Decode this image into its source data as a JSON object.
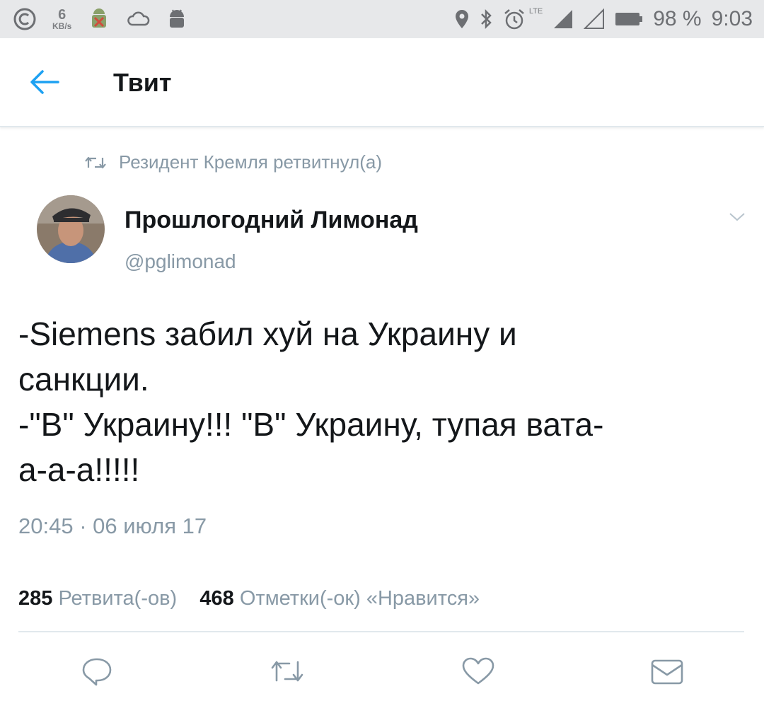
{
  "status_bar": {
    "net_speed_value": "6",
    "net_speed_unit": "KB/s",
    "network_type": "LTE",
    "battery": "98 %",
    "time": "9:03"
  },
  "header": {
    "title": "Твит"
  },
  "retweet": {
    "text": "Резидент Кремля ретвитнул(а)"
  },
  "author": {
    "name": "Прошлогодний Лимонад",
    "handle": "@pglimonad"
  },
  "tweet": {
    "lines": [
      "-Siemens забил хуй на Украину и",
      "санкции.",
      "-\"В\" Украину!!! \"В\" Украину, тупая вата-",
      "а-а-а!!!!!"
    ],
    "timestamp": "20:45 · 06 июля 17"
  },
  "stats": {
    "retweets_count": "285",
    "retweets_label": "Ретвита(-ов)",
    "likes_count": "468",
    "likes_label": "Отметки(-ок) «Нравится»"
  },
  "icons": {
    "back": "arrow-left-icon",
    "retweet": "retweet-icon",
    "caret": "chevron-down-icon",
    "reply": "reply-icon",
    "like": "heart-icon",
    "message": "envelope-icon"
  },
  "colors": {
    "accent": "#1da1f2",
    "secondary_text": "#8899a6",
    "primary_text": "#14171a"
  }
}
